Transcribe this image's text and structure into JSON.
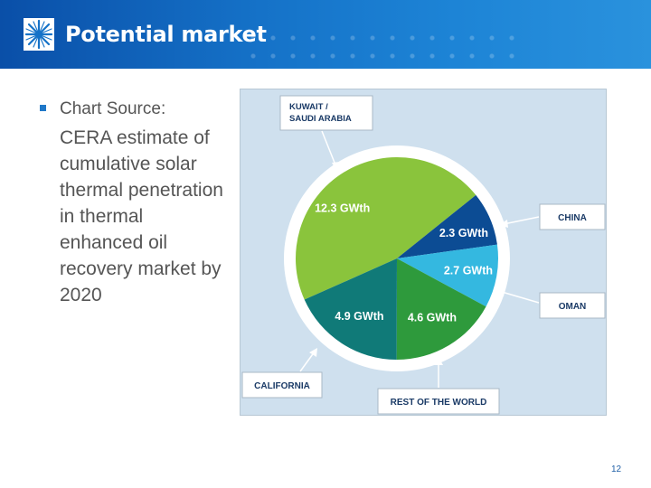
{
  "header": {
    "title": "Potential market"
  },
  "bullet": {
    "label": "Chart Source:",
    "text": "CERA estimate of cumulative solar thermal penetration in thermal enhanced oil recovery market by 2020"
  },
  "page_number": "12",
  "colors": {
    "header_blue": "#1572c8",
    "kuwait": "#8ac43c",
    "china": "#0c4c94",
    "oman": "#34b8e0",
    "rest_of_world": "#2e9a3c",
    "california": "#107a78"
  },
  "chart_data": {
    "type": "pie",
    "unit": "GWth",
    "slices": [
      {
        "name": "KUWAIT / SAUDI ARABIA",
        "value": 12.3,
        "label": "12.3 GWth",
        "color": "#8ac43c"
      },
      {
        "name": "CHINA",
        "value": 2.3,
        "label": "2.3 GWth",
        "color": "#0c4c94"
      },
      {
        "name": "OMAN",
        "value": 2.7,
        "label": "2.7 GWth",
        "color": "#34b8e0"
      },
      {
        "name": "REST OF THE WORLD",
        "value": 4.6,
        "label": "4.6 GWth",
        "color": "#2e9a3c"
      },
      {
        "name": "CALIFORNIA",
        "value": 4.9,
        "label": "4.9 GWth",
        "color": "#107a78"
      }
    ],
    "callouts": [
      "KUWAIT /",
      "SAUDI ARABIA",
      "CHINA",
      "OMAN",
      "CALIFORNIA",
      "REST OF THE WORLD"
    ]
  }
}
